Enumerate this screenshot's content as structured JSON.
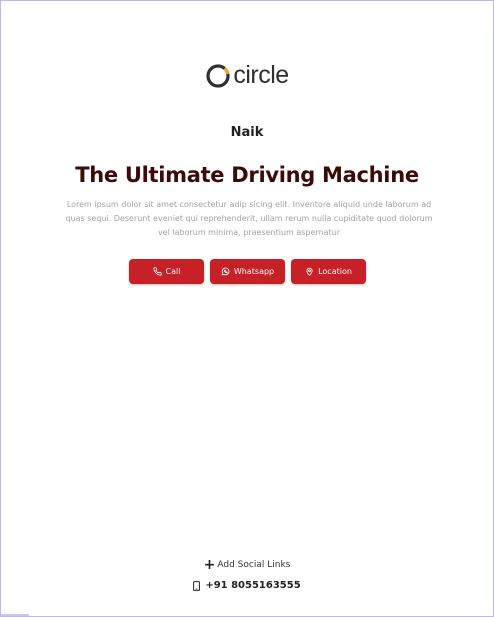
{
  "brand": {
    "logo_text": "circle"
  },
  "profile": {
    "name": "Naik",
    "headline": "The Ultimate Driving Machine",
    "description": "Lorem ipsum dolor sit amet consectetur adip sicing elit. Inventore aliquid unde laborum ad quas sequi. Deserunt eveniet qui reprehenderit, ullam rerum nulla cupiditate quod dolorum vel laborum minima, praesentium aspernatur"
  },
  "actions": {
    "call_label": "Call",
    "whatsapp_label": "Whatsapp",
    "location_label": "Location"
  },
  "footer": {
    "add_social_label": "Add Social Links",
    "phone": "+91 8055163555"
  },
  "colors": {
    "accent": "#c72026",
    "headline": "#3d0a0a",
    "logo_ring": "#f5a623"
  },
  "icons": {
    "call": "phone-icon",
    "whatsapp": "whatsapp-icon",
    "location": "map-pin-icon",
    "add": "plus-icon",
    "phone": "mobile-icon"
  }
}
